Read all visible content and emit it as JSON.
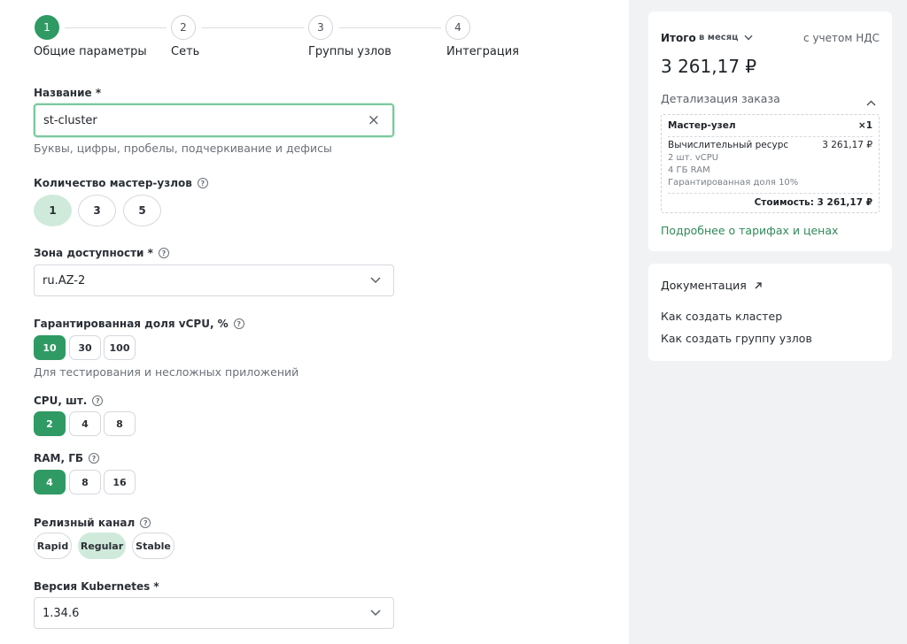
{
  "stepper": {
    "steps": [
      {
        "num": "1",
        "label": "Общие параметры",
        "active": true
      },
      {
        "num": "2",
        "label": "Сеть",
        "active": false
      },
      {
        "num": "3",
        "label": "Группы узлов",
        "active": false
      },
      {
        "num": "4",
        "label": "Интеграция",
        "active": false
      }
    ]
  },
  "form": {
    "name": {
      "label": "Название *",
      "value": "st-cluster",
      "hint": "Буквы, цифры, пробелы, подчеркивание и дефисы",
      "clear_icon": "×"
    },
    "masters": {
      "label": "Количество мастер-узлов",
      "options": [
        "1",
        "3",
        "5"
      ],
      "selected": "1"
    },
    "zone": {
      "label": "Зона доступности *",
      "value": "ru.AZ-2"
    },
    "vcpu_share": {
      "label": "Гарантированная доля vCPU, %",
      "options": [
        "10",
        "30",
        "100"
      ],
      "selected": "10",
      "hint": "Для тестирования и несложных приложений"
    },
    "cpu": {
      "label": "CPU, шт.",
      "options": [
        "2",
        "4",
        "8"
      ],
      "selected": "2"
    },
    "ram": {
      "label": "RAM, ГБ",
      "options": [
        "4",
        "8",
        "16"
      ],
      "selected": "4"
    },
    "channel": {
      "label": "Релизный канал",
      "options": [
        "Rapid",
        "Regular",
        "Stable"
      ],
      "selected": "Regular"
    },
    "k8s_version": {
      "label": "Версия Kubernetes *",
      "value": "1.34.6"
    }
  },
  "summary": {
    "total_label": "Итого",
    "period": "в месяц",
    "vat_note": "с учетом НДС",
    "total_price": "3 261,17 ₽",
    "details_title": "Детализация заказа",
    "item_title": "Мастер-узел",
    "item_qty": "×1",
    "resource_label": "Вычислительный ресурс",
    "resource_price": "3 261,17 ₽",
    "resource_lines": [
      "2 шт. vCPU",
      "4 ГБ RAM",
      "Гарантированная доля 10%"
    ],
    "cost_line": "Стоимость: 3 261,17 ₽",
    "tariffs_link": "Подробнее о тарифах и ценах"
  },
  "docs": {
    "title": "Документация",
    "links": [
      "Как создать кластер",
      "Как создать группу узлов"
    ]
  },
  "colors": {
    "accent": "#2f9a63",
    "accent_light": "#cfeadb",
    "link": "#2f8a58",
    "panel_bg": "#f1f2f4"
  }
}
